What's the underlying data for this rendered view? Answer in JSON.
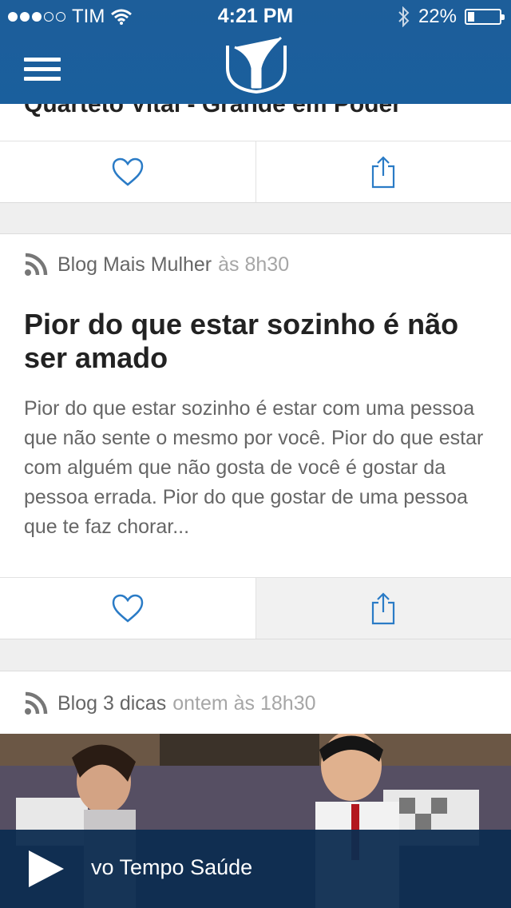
{
  "status_bar": {
    "carrier": "TIM",
    "time": "4:21 PM",
    "battery": "22%",
    "battery_level": 0.22
  },
  "previous_post": {
    "title": "Quarteto Vital - Grande em Poder"
  },
  "posts": [
    {
      "source": "Blog Mais Mulher",
      "time": "às 8h30",
      "title": "Pior do que estar sozinho é não ser amado",
      "excerpt": "Pior do que estar sozinho é estar com uma pessoa que não sente o mesmo por você. Pior do que estar com alguém que não gosta de você é gostar da pessoa errada. Pior do que gostar de uma pessoa que te faz chorar..."
    },
    {
      "source": "Blog 3 dicas",
      "time": "ontem às 18h30"
    }
  ],
  "player": {
    "title": "vo Tempo Saúde"
  },
  "colors": {
    "header": "#1a5f9d",
    "accent": "#2a7bc6",
    "player": "#0d2c50"
  }
}
